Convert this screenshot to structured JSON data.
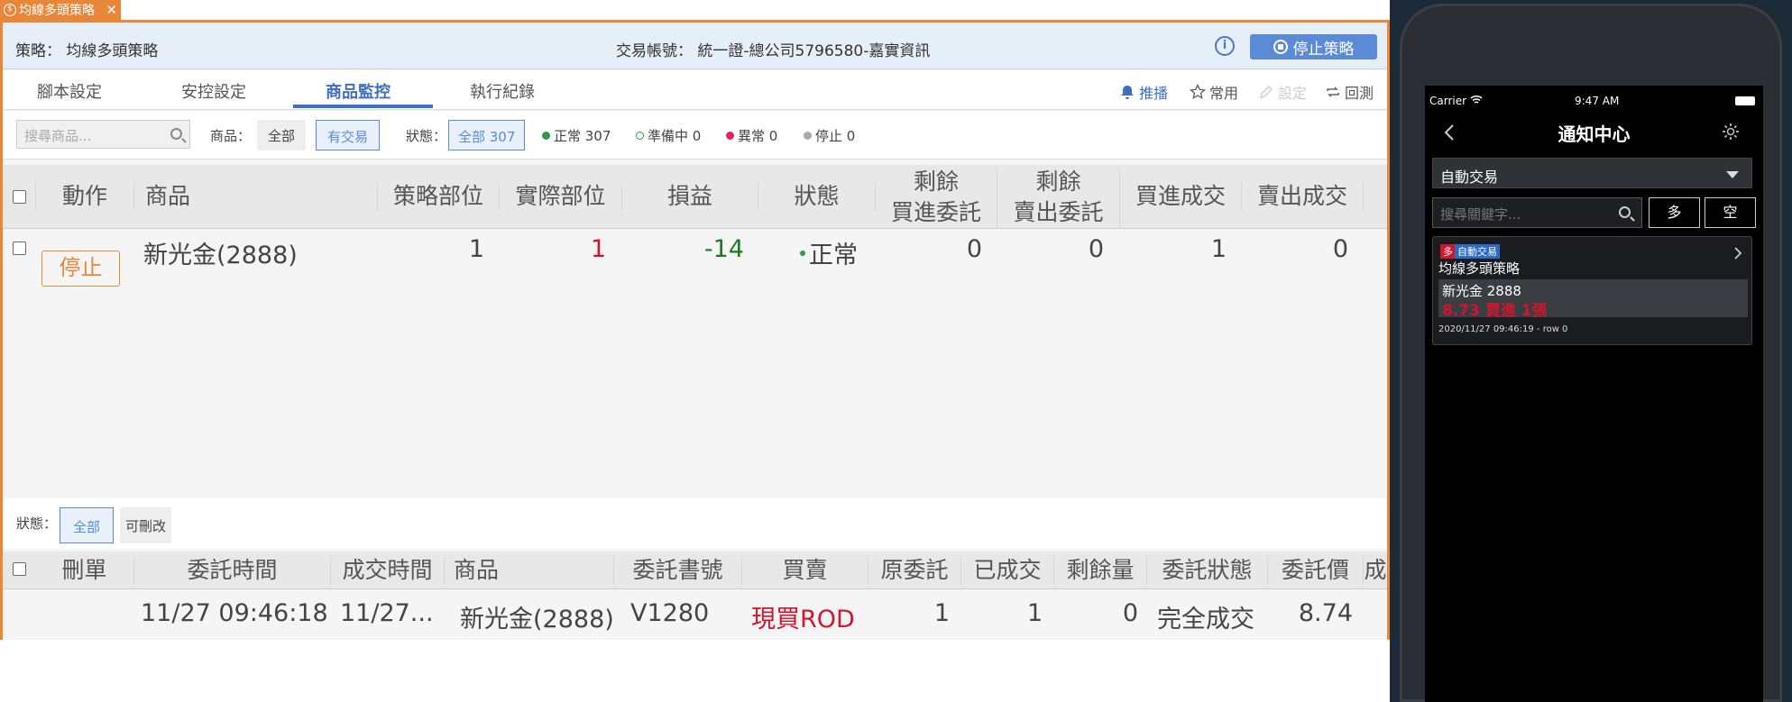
{
  "window_tab": {
    "icon": "$",
    "title": "均線多頭策略",
    "close": "✕"
  },
  "header": {
    "strategy_label": "策略： 均線多頭策略",
    "account_label": "交易帳號： 統一證-總公司5796580-嘉實資訊",
    "info_icon": "i",
    "stop_button": "停止策略"
  },
  "tabs": [
    "腳本設定",
    "安控設定",
    "商品監控",
    "執行紀錄"
  ],
  "active_tab": 2,
  "tools": {
    "broadcast": "推播",
    "favorite": "常用",
    "settings": "設定",
    "backtest": "回測"
  },
  "filters": {
    "search_placeholder": "搜尋商品...",
    "product_label": "商品：",
    "product_all": "全部",
    "product_traded": "有交易",
    "status_label": "狀態：",
    "status_all": "全部 307",
    "status_normal": "正常 307",
    "status_ready": "準備中 0",
    "status_abnormal": "異常 0",
    "status_stopped": "停止 0"
  },
  "monitor_table": {
    "headers": [
      "動作",
      "商品",
      "策略部位",
      "實際部位",
      "損益",
      "狀態",
      "剩餘",
      "買進委託",
      "剩餘",
      "賣出委託",
      "買進成交",
      "賣出成交"
    ],
    "row": {
      "action": "停止",
      "product": "新光金(2888)",
      "strategy_pos": "1",
      "actual_pos": "1",
      "pnl": "-14",
      "status": "正常",
      "remain_buy": "0",
      "remain_sell": "0",
      "buy_filled": "1",
      "sell_filled": "0"
    }
  },
  "order_filter": {
    "label": "狀態：",
    "all": "全部",
    "modifiable": "可刪改"
  },
  "order_table": {
    "headers": [
      "刪單",
      "委託時間",
      "成交時間",
      "商品",
      "委託書號",
      "買賣",
      "原委託",
      "已成交",
      "剩餘量",
      "委託狀態",
      "委託價",
      "成"
    ],
    "row": {
      "order_time": "11/27 09:46:18",
      "fill_time": "11/27...",
      "product": "新光金(2888)",
      "order_no": "V1280",
      "side": "現買ROD",
      "orig": "1",
      "filled": "1",
      "remaining": "0",
      "status": "完全成交",
      "price": "8.74"
    }
  },
  "phone": {
    "carrier": "Carrier",
    "time": "9:47 AM",
    "title": "通知中心",
    "dropdown": "自動交易",
    "search_placeholder": "搜尋關鍵字...",
    "long_btn": "多",
    "short_btn": "空",
    "card": {
      "badge_long": "多",
      "badge_type": "自動交易",
      "strategy": "均線多頭策略",
      "product": "新光金 2888",
      "detail": "8.73 買進 1張",
      "footer": "2020/11/27 09:46:19 - row 0"
    }
  },
  "colors": {
    "accent_orange": "#e8873a",
    "accent_blue": "#5b8ad6",
    "loss_green": "#1e7a1e",
    "red": "#d0152d"
  }
}
